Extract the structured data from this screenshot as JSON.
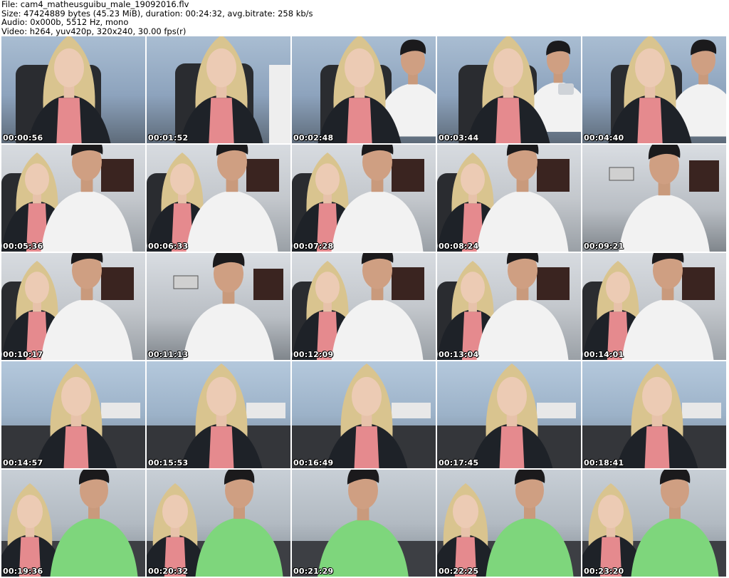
{
  "header": {
    "line1": "File: cam4_matheusguibu_male_19092016.flv",
    "line2": "Size: 47424889 bytes (45.23 MiB), duration: 00:24:32, avg.bitrate: 258 kb/s",
    "line3": "Audio: 0x000b, 5512 Hz, mono",
    "line4": "Video: h264, yuv420p, 320x240, 30.00 fps(r)"
  },
  "thumbnails": [
    {
      "time": "00:00:56",
      "scene": "woman-alone"
    },
    {
      "time": "00:01:52",
      "scene": "woman-with-man-edge"
    },
    {
      "time": "00:02:48",
      "scene": "woman-and-man"
    },
    {
      "time": "00:03:44",
      "scene": "woman-and-man-phone"
    },
    {
      "time": "00:04:40",
      "scene": "woman-and-man"
    },
    {
      "time": "00:05:36",
      "scene": "couple-room"
    },
    {
      "time": "00:06:33",
      "scene": "couple-room"
    },
    {
      "time": "00:07:28",
      "scene": "couple-room"
    },
    {
      "time": "00:08:24",
      "scene": "couple-room"
    },
    {
      "time": "00:09:21",
      "scene": "man-alone-room"
    },
    {
      "time": "00:10:17",
      "scene": "couple-room"
    },
    {
      "time": "00:11:13",
      "scene": "man-alone-room"
    },
    {
      "time": "00:12:09",
      "scene": "couple-room"
    },
    {
      "time": "00:13:04",
      "scene": "couple-room"
    },
    {
      "time": "00:14:01",
      "scene": "couple-room"
    },
    {
      "time": "00:14:57",
      "scene": "woman-close"
    },
    {
      "time": "00:15:53",
      "scene": "woman-close"
    },
    {
      "time": "00:16:49",
      "scene": "woman-close"
    },
    {
      "time": "00:17:45",
      "scene": "woman-close"
    },
    {
      "time": "00:18:41",
      "scene": "woman-close"
    },
    {
      "time": "00:19:36",
      "scene": "couple-green"
    },
    {
      "time": "00:20:32",
      "scene": "couple-green"
    },
    {
      "time": "00:21:29",
      "scene": "man-green"
    },
    {
      "time": "00:22:25",
      "scene": "couple-green"
    },
    {
      "time": "00:23:20",
      "scene": "couple-green"
    }
  ],
  "colors": {
    "timestamp_text": "#ffffff",
    "timestamp_outline": "#000000",
    "header_text": "#000000"
  }
}
